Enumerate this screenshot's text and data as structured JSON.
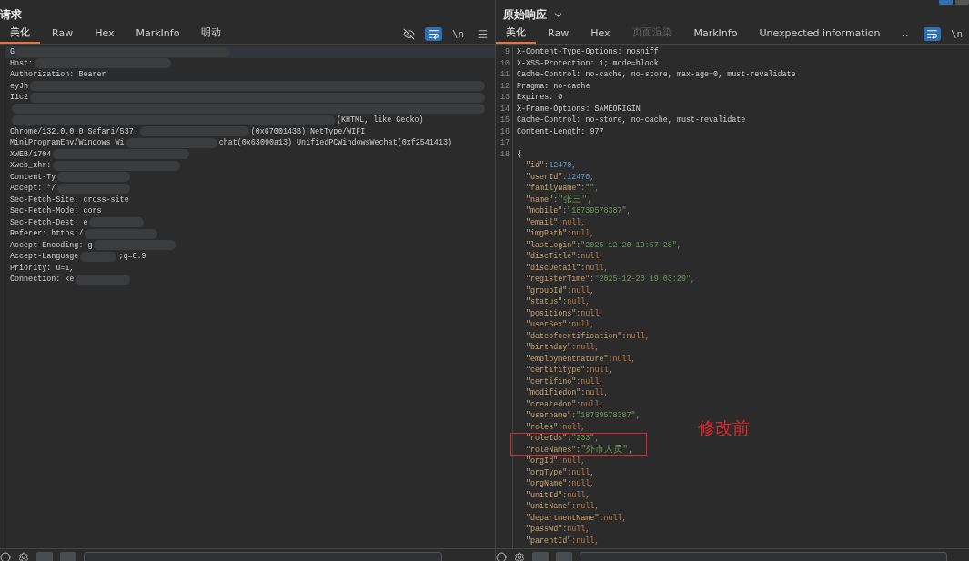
{
  "request": {
    "title": "请求",
    "tabs": [
      {
        "label": "美化",
        "selected": true,
        "disabled": false
      },
      {
        "label": "Raw",
        "selected": false,
        "disabled": false
      },
      {
        "label": "Hex",
        "selected": false,
        "disabled": false
      },
      {
        "label": "MarkInfo",
        "selected": false,
        "disabled": false
      },
      {
        "label": "明动",
        "selected": false,
        "disabled": false
      }
    ],
    "tools": [
      {
        "kind": "hide",
        "active": false
      },
      {
        "kind": "wrap",
        "active": true
      },
      {
        "kind": "newline",
        "label": "\\n",
        "active": false
      },
      {
        "kind": "menu",
        "active": false
      }
    ],
    "lines": [
      {
        "current": true,
        "segments": [
          {
            "kind": "text",
            "text": "G"
          },
          {
            "kind": "redacted"
          }
        ]
      },
      {
        "current": false,
        "segments": [
          {
            "kind": "text",
            "text": "Host:"
          },
          {
            "kind": "redacted"
          }
        ]
      },
      {
        "current": false,
        "segments": [
          {
            "kind": "text",
            "text": "Authorization: Bearer"
          }
        ]
      },
      {
        "current": false,
        "segments": [
          {
            "kind": "text",
            "text": "eyJh"
          },
          {
            "kind": "redacted"
          }
        ]
      },
      {
        "current": false,
        "segments": [
          {
            "kind": "text",
            "text": "I1c2"
          },
          {
            "kind": "redacted"
          }
        ]
      },
      {
        "current": false,
        "segments": [
          {
            "kind": "redacted"
          }
        ]
      },
      {
        "current": false,
        "segments": [
          {
            "kind": "redacted"
          },
          {
            "kind": "text",
            "text": "(KHTML, like Gecko)"
          }
        ]
      },
      {
        "current": false,
        "segments": [
          {
            "kind": "text",
            "text": "Chrome/132.0.0.0 Safari/537."
          },
          {
            "kind": "redacted"
          },
          {
            "kind": "text",
            "text": "(0x6700143B) NetType/WIFI"
          }
        ]
      },
      {
        "current": false,
        "segments": [
          {
            "kind": "text",
            "text": "MiniProgramEnv/Windows Wi"
          },
          {
            "kind": "redacted"
          },
          {
            "kind": "text",
            "text": "chat(0x63090a13) UnifiedPCWindowsWechat(0xf2541413)"
          }
        ]
      },
      {
        "current": false,
        "segments": [
          {
            "kind": "text",
            "text": "XWEB/1704"
          },
          {
            "kind": "redacted"
          }
        ]
      },
      {
        "current": false,
        "segments": [
          {
            "kind": "text",
            "text": "Xweb_xhr:"
          },
          {
            "kind": "redacted"
          }
        ]
      },
      {
        "current": false,
        "segments": [
          {
            "kind": "text",
            "text": "Content-Ty"
          },
          {
            "kind": "redacted"
          }
        ]
      },
      {
        "current": false,
        "segments": [
          {
            "kind": "text",
            "text": "Accept: */"
          },
          {
            "kind": "redacted"
          }
        ]
      },
      {
        "current": false,
        "segments": [
          {
            "kind": "text",
            "text": "Sec-Fetch-Site: cross-site"
          }
        ]
      },
      {
        "current": false,
        "segments": [
          {
            "kind": "text",
            "text": "Sec-Fetch-Mode: cors"
          }
        ]
      },
      {
        "current": false,
        "segments": [
          {
            "kind": "text",
            "text": "Sec-Fetch-Dest: e"
          },
          {
            "kind": "redacted"
          }
        ]
      },
      {
        "current": false,
        "segments": [
          {
            "kind": "text",
            "text": "Referer: https:/"
          },
          {
            "kind": "redacted"
          }
        ]
      },
      {
        "current": false,
        "segments": [
          {
            "kind": "text",
            "text": "Accept-Encoding: g"
          },
          {
            "kind": "redacted"
          }
        ]
      },
      {
        "current": false,
        "segments": [
          {
            "kind": "text",
            "text": "Accept-Language"
          },
          {
            "kind": "redacted"
          },
          {
            "kind": "text",
            "text": ";q=0.9"
          }
        ]
      },
      {
        "current": false,
        "segments": [
          {
            "kind": "text",
            "text": "Priority: u=1,"
          }
        ]
      },
      {
        "current": false,
        "segments": [
          {
            "kind": "text",
            "text": "Connection: ke"
          },
          {
            "kind": "redacted"
          }
        ]
      }
    ]
  },
  "response": {
    "title": "原始响应",
    "tabs": [
      {
        "label": "美化",
        "selected": true,
        "disabled": false
      },
      {
        "label": "Raw",
        "selected": false,
        "disabled": false
      },
      {
        "label": "Hex",
        "selected": false,
        "disabled": false
      },
      {
        "label": "页面渲染",
        "selected": false,
        "disabled": true
      },
      {
        "label": "MarkInfo",
        "selected": false,
        "disabled": false
      },
      {
        "label": "Unexpected information",
        "selected": false,
        "disabled": false
      },
      {
        "label": "..",
        "selected": false,
        "disabled": false
      }
    ],
    "tools": [
      {
        "kind": "wrap",
        "active": true
      },
      {
        "kind": "newline",
        "label": "\\n",
        "active": false
      }
    ],
    "header_lines": [
      {
        "number": "9",
        "text": "X-Content-Type-Options: nosniff"
      },
      {
        "number": "10",
        "text": "X-XSS-Protection: 1; mode=block"
      },
      {
        "number": "11",
        "text": "Cache-Control: no-cache, no-store, max-age=0, must-revalidate"
      },
      {
        "number": "12",
        "text": "Pragma: no-cache"
      },
      {
        "number": "13",
        "text": "Expires: 0"
      },
      {
        "number": "14",
        "text": "X-Frame-Options: SAMEORIGIN"
      },
      {
        "number": "15",
        "text": "Cache-Control: no-store, no-cache, must-revalidate"
      },
      {
        "number": "16",
        "text": "Content-Length: 977"
      },
      {
        "number": "17"
      },
      {
        "number": "18",
        "text": "{"
      }
    ],
    "json_lines": [
      {
        "key": "\"id\":",
        "value": "12470,",
        "kind": "number",
        "boxed": false
      },
      {
        "key": "\"userId\":",
        "value": "12470,",
        "kind": "number",
        "boxed": false
      },
      {
        "key": "\"familyName\":",
        "value": "\"\",",
        "kind": "string",
        "boxed": false
      },
      {
        "key": "\"name\":",
        "value": "\"张三\",",
        "kind": "string",
        "boxed": false
      },
      {
        "key": "\"mobile\":",
        "value": "\"18739578387\",",
        "kind": "string",
        "boxed": false
      },
      {
        "key": "\"email\":",
        "value": "null,",
        "kind": "null",
        "boxed": false
      },
      {
        "key": "\"imgPath\":",
        "value": "null,",
        "kind": "null",
        "boxed": false
      },
      {
        "key": "\"lastLogin\":",
        "value": "\"2025-12-20 19:57:28\",",
        "kind": "string",
        "boxed": false
      },
      {
        "key": "\"discTitle\":",
        "value": "null,",
        "kind": "null",
        "boxed": false
      },
      {
        "key": "\"discDetail\":",
        "value": "null,",
        "kind": "null",
        "boxed": false
      },
      {
        "key": "\"registerTime\":",
        "value": "\"2025-12-20 19:03:29\",",
        "kind": "string",
        "boxed": false
      },
      {
        "key": "\"groupId\":",
        "value": "null,",
        "kind": "null",
        "boxed": false
      },
      {
        "key": "\"status\":",
        "value": "null,",
        "kind": "null",
        "boxed": false
      },
      {
        "key": "\"positions\":",
        "value": "null,",
        "kind": "null",
        "boxed": false
      },
      {
        "key": "\"userSex\":",
        "value": "null,",
        "kind": "null",
        "boxed": false
      },
      {
        "key": "\"dateofcertification\":",
        "value": "null,",
        "kind": "null",
        "boxed": false
      },
      {
        "key": "\"birthday\":",
        "value": "null,",
        "kind": "null",
        "boxed": false
      },
      {
        "key": "\"employmentnature\":",
        "value": "null,",
        "kind": "null",
        "boxed": false
      },
      {
        "key": "\"certifitype\":",
        "value": "null,",
        "kind": "null",
        "boxed": false
      },
      {
        "key": "\"certifino\":",
        "value": "null,",
        "kind": "null",
        "boxed": false
      },
      {
        "key": "\"modifiedon\":",
        "value": "null,",
        "kind": "null",
        "boxed": false
      },
      {
        "key": "\"createdon\":",
        "value": "null,",
        "kind": "null",
        "boxed": false
      },
      {
        "key": "\"username\":",
        "value": "\"18739578387\",",
        "kind": "string",
        "boxed": false
      },
      {
        "key": "\"roles\":",
        "value": "null,",
        "kind": "null",
        "boxed": false
      },
      {
        "key": "\"roleIds\":",
        "value": "\"233\",",
        "kind": "string",
        "boxed": true
      },
      {
        "key": "\"roleNames\":",
        "value": "\"外市人员\",",
        "kind": "string",
        "boxed": true
      },
      {
        "key": "\"orgId\":",
        "value": "null,",
        "kind": "null",
        "boxed": false
      },
      {
        "key": "\"orgType\":",
        "value": "null,",
        "kind": "null",
        "boxed": false
      },
      {
        "key": "\"orgName\":",
        "value": "null,",
        "kind": "null",
        "boxed": false
      },
      {
        "key": "\"unitId\":",
        "value": "null,",
        "kind": "null",
        "boxed": false
      },
      {
        "key": "\"unitName\":",
        "value": "null,",
        "kind": "null",
        "boxed": false
      },
      {
        "key": "\"departmentName\":",
        "value": "null,",
        "kind": "null",
        "boxed": false
      },
      {
        "key": "\"passwd\":",
        "value": "null,",
        "kind": "null",
        "boxed": false
      },
      {
        "key": "\"parentId\":",
        "value": "null,",
        "kind": "null",
        "boxed": false
      }
    ],
    "annotation": "修改前"
  }
}
